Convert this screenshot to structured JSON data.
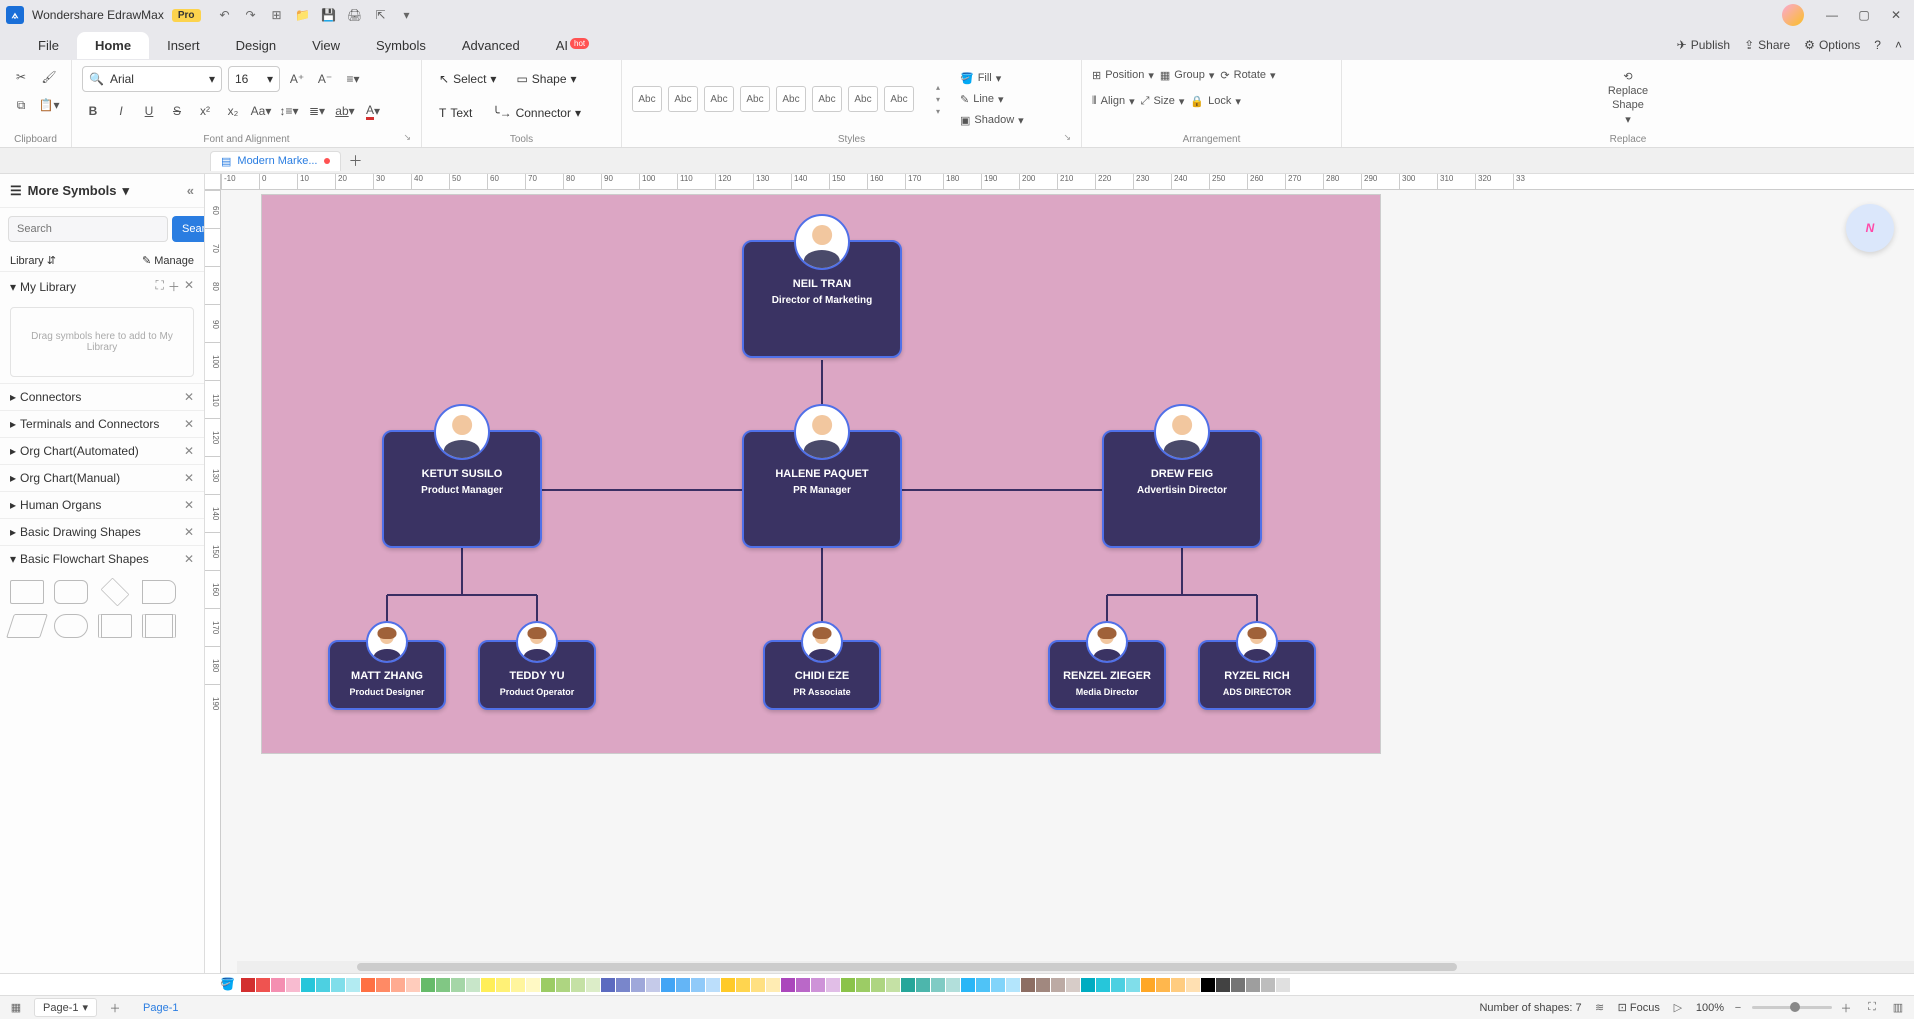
{
  "app": {
    "title": "Wondershare EdrawMax",
    "pro": "Pro"
  },
  "menubar": {
    "items": [
      "File",
      "Home",
      "Insert",
      "Design",
      "View",
      "Symbols",
      "Advanced",
      "AI"
    ],
    "active": "Home",
    "hot": "hot",
    "right": {
      "publish": "Publish",
      "share": "Share",
      "options": "Options"
    }
  },
  "ribbon": {
    "clipboard": {
      "label": "Clipboard"
    },
    "font": {
      "label": "Font and Alignment",
      "family": "Arial",
      "size": "16"
    },
    "tools": {
      "label": "Tools",
      "select": "Select",
      "shape": "Shape",
      "text": "Text",
      "connector": "Connector"
    },
    "styles": {
      "label": "Styles",
      "swatch": "Abc",
      "fill": "Fill",
      "line": "Line",
      "shadow": "Shadow"
    },
    "arrangement": {
      "label": "Arrangement",
      "position": "Position",
      "group": "Group",
      "rotate": "Rotate",
      "align": "Align",
      "size": "Size",
      "lock": "Lock"
    },
    "replace": {
      "label": "Replace",
      "btn1": "Replace",
      "btn2": "Shape"
    }
  },
  "doc_tab": {
    "name": "Modern Marke..."
  },
  "sidebar": {
    "title": "More Symbols",
    "search_placeholder": "Search",
    "search_btn": "Search",
    "library_label": "Library",
    "manage": "Manage",
    "mylib": "My Library",
    "drop_hint": "Drag symbols here to add to My Library",
    "sections": [
      "Connectors",
      "Terminals and Connectors",
      "Org Chart(Automated)",
      "Org Chart(Manual)",
      "Human Organs",
      "Basic Drawing Shapes",
      "Basic Flowchart Shapes"
    ]
  },
  "ruler_h": [
    "-10",
    "0",
    "10",
    "20",
    "30",
    "40",
    "50",
    "60",
    "70",
    "80",
    "90",
    "100",
    "110",
    "120",
    "130",
    "140",
    "150",
    "160",
    "170",
    "180",
    "190",
    "200",
    "210",
    "220",
    "230",
    "240",
    "250",
    "260",
    "270",
    "280",
    "290",
    "300",
    "310",
    "320",
    "33"
  ],
  "ruler_v": [
    "60",
    "70",
    "80",
    "90",
    "100",
    "110",
    "120",
    "130",
    "140",
    "150",
    "160",
    "170",
    "180",
    "190"
  ],
  "org": {
    "root": {
      "name": "NEIL TRAN",
      "role": "Director of Marketing"
    },
    "l2": [
      {
        "name": "KETUT SUSILO",
        "role": "Product Manager"
      },
      {
        "name": "HALENE PAQUET",
        "role": "PR Manager"
      },
      {
        "name": "DREW FEIG",
        "role": "Advertisin Director"
      }
    ],
    "l3a": [
      {
        "name": "MATT ZHANG",
        "role": "Product Designer"
      },
      {
        "name": "TEDDY YU",
        "role": "Product Operator"
      }
    ],
    "l3b": [
      {
        "name": "CHIDI EZE",
        "role": "PR Associate"
      }
    ],
    "l3c": [
      {
        "name": "RENZEL ZIEGER",
        "role": "Media Director"
      },
      {
        "name": "RYZEL RICH",
        "role": "ADS DIRECTOR"
      }
    ]
  },
  "colorbar": [
    "#d32f2f",
    "#ef5350",
    "#f48fb1",
    "#f8bbd0",
    "#26c6da",
    "#4dd0e1",
    "#80deea",
    "#b2ebf2",
    "#ff7043",
    "#ff8a65",
    "#ffab91",
    "#ffccbc",
    "#66bb6a",
    "#81c784",
    "#a5d6a7",
    "#c8e6c9",
    "#ffee58",
    "#fff176",
    "#fff59d",
    "#fff9c4",
    "#9ccc65",
    "#aed581",
    "#c5e1a5",
    "#dcedc8",
    "#5c6bc0",
    "#7986cb",
    "#9fa8da",
    "#c5cae9",
    "#42a5f5",
    "#64b5f6",
    "#90caf9",
    "#bbdefb",
    "#ffca28",
    "#ffd54f",
    "#ffe082",
    "#ffecb3",
    "#ab47bc",
    "#ba68c8",
    "#ce93d8",
    "#e1bee7",
    "#8bc34a",
    "#9ccc65",
    "#aed581",
    "#c5e1a5",
    "#26a69a",
    "#4db6ac",
    "#80cbc4",
    "#b2dfdb",
    "#29b6f6",
    "#4fc3f7",
    "#81d4fa",
    "#b3e5fc",
    "#8d6e63",
    "#a1887f",
    "#bcaaa4",
    "#d7ccc8",
    "#00acc1",
    "#26c6da",
    "#4dd0e1",
    "#80deea",
    "#ffa726",
    "#ffb74d",
    "#ffcc80",
    "#ffe0b2",
    "#000000",
    "#424242",
    "#757575",
    "#9e9e9e",
    "#bdbdbd",
    "#e0e0e0",
    "#ffffff"
  ],
  "status": {
    "page_dd": "Page-1",
    "page_tab": "Page-1",
    "shapes": "Number of shapes: 7",
    "focus": "Focus",
    "zoom": "100%"
  }
}
